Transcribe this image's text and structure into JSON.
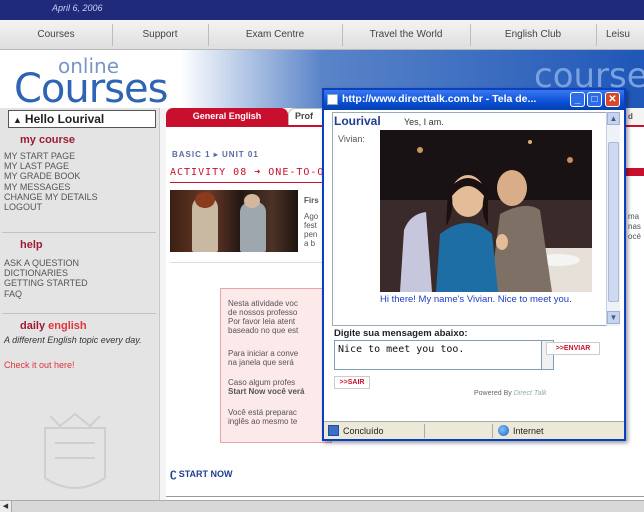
{
  "date": "April 6, 2006",
  "nav": [
    "Courses",
    "Support",
    "Exam Centre",
    "Travel the World",
    "English Club",
    "Leisu"
  ],
  "logo": {
    "online": "online",
    "courses": "Courses",
    "banner_right": "course"
  },
  "sidebar": {
    "hello": "Hello Lourival",
    "my_course_title": {
      "my": "my",
      "course": "course"
    },
    "my_course_items": [
      "MY START PAGE",
      "MY LAST PAGE",
      "MY GRADE BOOK",
      "MY MESSAGES",
      "CHANGE MY DETAILS",
      "LOGOUT"
    ],
    "help_title": "help",
    "help_items": [
      "ASK A QUESTION",
      "DICTIONARIES",
      "GETTING STARTED",
      "FAQ"
    ],
    "daily_title": {
      "daily": "daily",
      "english": "english"
    },
    "daily_text": "A different English topic every day.",
    "daily_link": "Check it out here!"
  },
  "tabs": {
    "general": "General English",
    "pro": "Prof"
  },
  "content": {
    "breadcrumb": "BASIC 1 ▸ UNIT 01",
    "activity_label": "ACTIVITY 08 ➜ ONE-TO-O",
    "snippet_lines": [
      "Firs",
      "Ago",
      "fest",
      "pen",
      "a b"
    ],
    "info_lines": [
      "Nesta atividade voc",
      "de nossos professo",
      "Por favor leia atent",
      "baseado no que est",
      "",
      "Para iniciar a conve",
      "na janela que será",
      "",
      "Caso algum profes",
      "Start Now você verá",
      "",
      "Você está preparac",
      "inglês ao mesmo te"
    ],
    "start_now": "START NOW",
    "right_snips": [
      "d",
      "ma",
      "nas",
      "océ"
    ]
  },
  "popup": {
    "title": "http://www.directtalk.com.br - Tela de...",
    "user_name": "Lourival",
    "user_message": "Yes, I am.",
    "vivian_label": "Vivian:",
    "vivian_message": "Hi there! My name's Vivian. Nice to meet you.",
    "prompt": "Digite sua mensagem abaixo:",
    "message_value": "Nice to meet you too.",
    "send_button": ">>ENVIAR",
    "exit_button": ">>SAIR",
    "powered_by": "Powered By",
    "powered_brand": "Direct Talk",
    "status_text": "Concluído",
    "zone_text": "Internet"
  }
}
